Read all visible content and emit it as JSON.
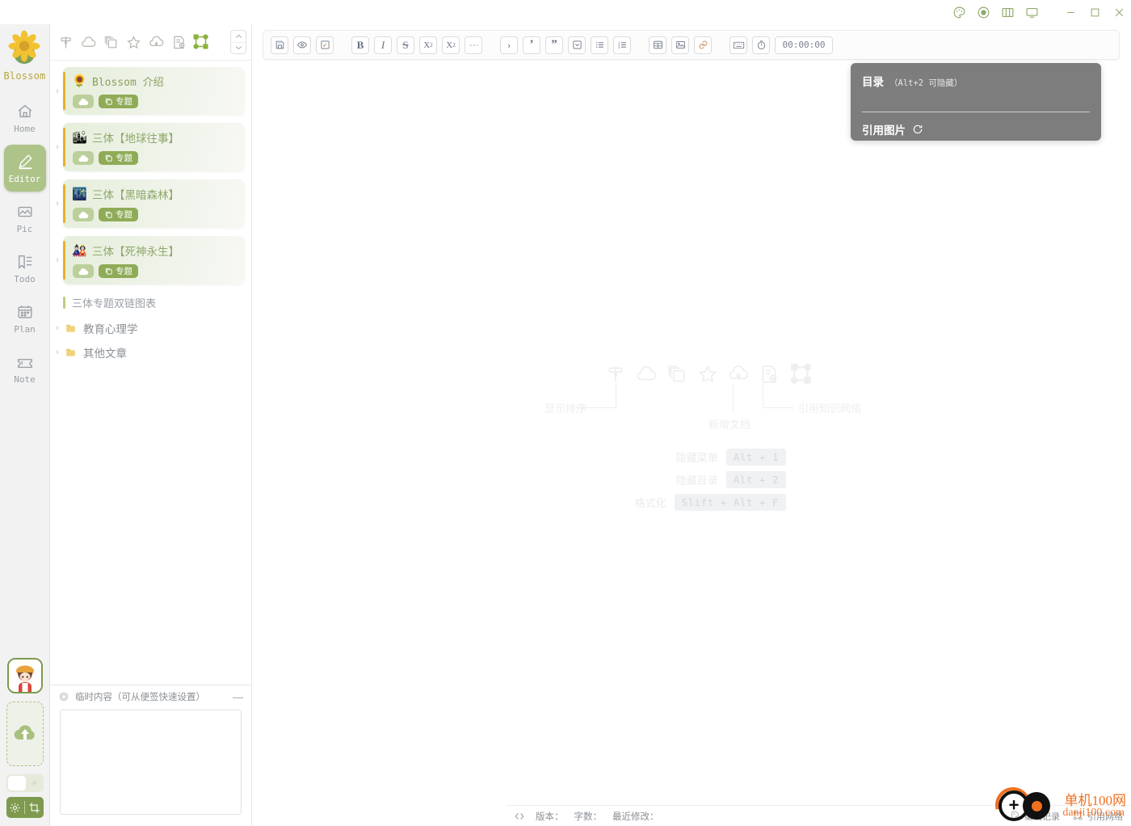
{
  "titlebar": {
    "icons": [
      {
        "name": "palette-icon",
        "label": "主题"
      },
      {
        "name": "record-icon",
        "label": "录制"
      },
      {
        "name": "columns-icon",
        "label": "分栏"
      },
      {
        "name": "screen-icon",
        "label": "全屏"
      }
    ],
    "window_controls": [
      {
        "name": "minimize-button",
        "label": "—"
      },
      {
        "name": "maximize-button",
        "label": "□"
      },
      {
        "name": "close-button",
        "label": "✕"
      }
    ],
    "accent_color": "#8fa86a"
  },
  "rail": {
    "logo_name": "Blossom",
    "items": [
      {
        "label": "Home",
        "icon": "home-icon",
        "active": false
      },
      {
        "label": "Editor",
        "icon": "editor-icon",
        "active": true
      },
      {
        "label": "Pic",
        "icon": "picture-icon",
        "active": false
      },
      {
        "label": "Todo",
        "icon": "todo-icon",
        "active": false
      },
      {
        "label": "Plan",
        "icon": "calendar-icon",
        "active": false
      },
      {
        "label": "Note",
        "icon": "ticket-icon",
        "active": false
      }
    ],
    "active_color": "#adc388",
    "bottom": {
      "avatar_name": "user-avatar",
      "dropzone_name": "upload-dropzone",
      "theme_toggle_name": "theme-toggle",
      "settings_name": "settings-button",
      "crop_name": "crop-button"
    }
  },
  "sidebar": {
    "toolbar": [
      {
        "name": "sort-display-icon",
        "title": "显示排序"
      },
      {
        "name": "cloud-icon",
        "title": "云同步"
      },
      {
        "name": "copy-stack-icon",
        "title": "副本"
      },
      {
        "name": "star-icon",
        "title": "收藏"
      },
      {
        "name": "cloud-download-icon",
        "title": "拉取"
      },
      {
        "name": "new-document-icon",
        "title": "新增文档"
      },
      {
        "name": "knowledge-network-icon",
        "title": "引用知识网络",
        "active": true
      }
    ],
    "stepper": {
      "up": "︿",
      "down": "﹀"
    },
    "documents": [
      {
        "emoji": "🌻",
        "title": "Blossom 介绍",
        "mono": true,
        "badges": [
          "cloud",
          "专题"
        ]
      },
      {
        "emoji": "🏙",
        "title": "三体【地球往事】",
        "mono": false,
        "badges": [
          "cloud",
          "专题"
        ]
      },
      {
        "emoji": "🌃",
        "title": "三体【黑暗森林】",
        "mono": false,
        "badges": [
          "cloud",
          "专题"
        ]
      },
      {
        "emoji": "🎎",
        "title": "三体【死神永生】",
        "mono": false,
        "badges": [
          "cloud",
          "专题"
        ]
      }
    ],
    "badge_topic_label": "专题",
    "link_item": "三体专题双链图表",
    "folders": [
      {
        "label": "教育心理学"
      },
      {
        "label": "其他文章"
      }
    ],
    "temp_panel": {
      "title": "临时内容（可从便签快速设置）",
      "minimize": "—",
      "textarea_placeholder": ""
    }
  },
  "editor": {
    "toolbar_groups": [
      [
        {
          "name": "save-button",
          "glyph": "save"
        },
        {
          "name": "preview-button",
          "glyph": "eye"
        },
        {
          "name": "fullscreen-button",
          "glyph": "expand"
        }
      ],
      [
        {
          "name": "bold-button",
          "glyph": "B"
        },
        {
          "name": "italic-button",
          "glyph": "I"
        },
        {
          "name": "strikethrough-button",
          "glyph": "S"
        },
        {
          "name": "superscript-button",
          "glyph": "X²"
        },
        {
          "name": "subscript-button",
          "glyph": "X₂"
        },
        {
          "name": "horizontal-rule-button",
          "glyph": "—"
        }
      ],
      [
        {
          "name": "indent-button",
          "glyph": "›"
        },
        {
          "name": "single-quote-button",
          "glyph": "’"
        },
        {
          "name": "blockquote-button",
          "glyph": "”"
        },
        {
          "name": "collapse-block-button",
          "glyph": "⌄"
        },
        {
          "name": "unordered-list-button",
          "glyph": "ul"
        },
        {
          "name": "ordered-list-button",
          "glyph": "ol"
        }
      ],
      [
        {
          "name": "table-button",
          "glyph": "table"
        },
        {
          "name": "image-button",
          "glyph": "image"
        },
        {
          "name": "link-button",
          "glyph": "link"
        }
      ],
      [
        {
          "name": "keyboard-button",
          "glyph": "keyboard"
        },
        {
          "name": "pomodoro-button",
          "glyph": "timer"
        }
      ]
    ],
    "timer_value": "00:00:00"
  },
  "outline_panel": {
    "title": "目录",
    "hint": "（Alt+2 可隐藏）",
    "link_label": "引用图片",
    "refresh_icon": "refresh-icon",
    "background": "#7d7d7d"
  },
  "hints": {
    "icons": [
      {
        "name": "sort-display-icon"
      },
      {
        "name": "cloud-icon"
      },
      {
        "name": "copy-stack-icon"
      },
      {
        "name": "star-icon"
      },
      {
        "name": "cloud-download-icon"
      },
      {
        "name": "new-document-icon"
      },
      {
        "name": "knowledge-network-icon"
      }
    ],
    "labels": {
      "sort": "显示排序",
      "new_doc": "新增文档",
      "network": "引用知识网络"
    },
    "shortcuts": [
      {
        "name": "隐藏菜单",
        "keys": "Alt + 1"
      },
      {
        "name": "隐藏目录",
        "keys": "Alt + 2"
      },
      {
        "name": "格式化",
        "keys": "Slift + Alt + F"
      }
    ]
  },
  "statusbar": {
    "code_icon": "code-icon",
    "version_label": "版本：",
    "words_label": "字数：",
    "modified_label": "最近修改：",
    "right_items": [
      {
        "name": "edit-history",
        "label": "编辑记录",
        "icon": "history-icon"
      },
      {
        "name": "reference-network",
        "label": "引用网络",
        "icon": "network-icon"
      }
    ]
  },
  "watermark": {
    "line1": "单机100网",
    "line2": "danji100.com",
    "color": "#f07020"
  }
}
